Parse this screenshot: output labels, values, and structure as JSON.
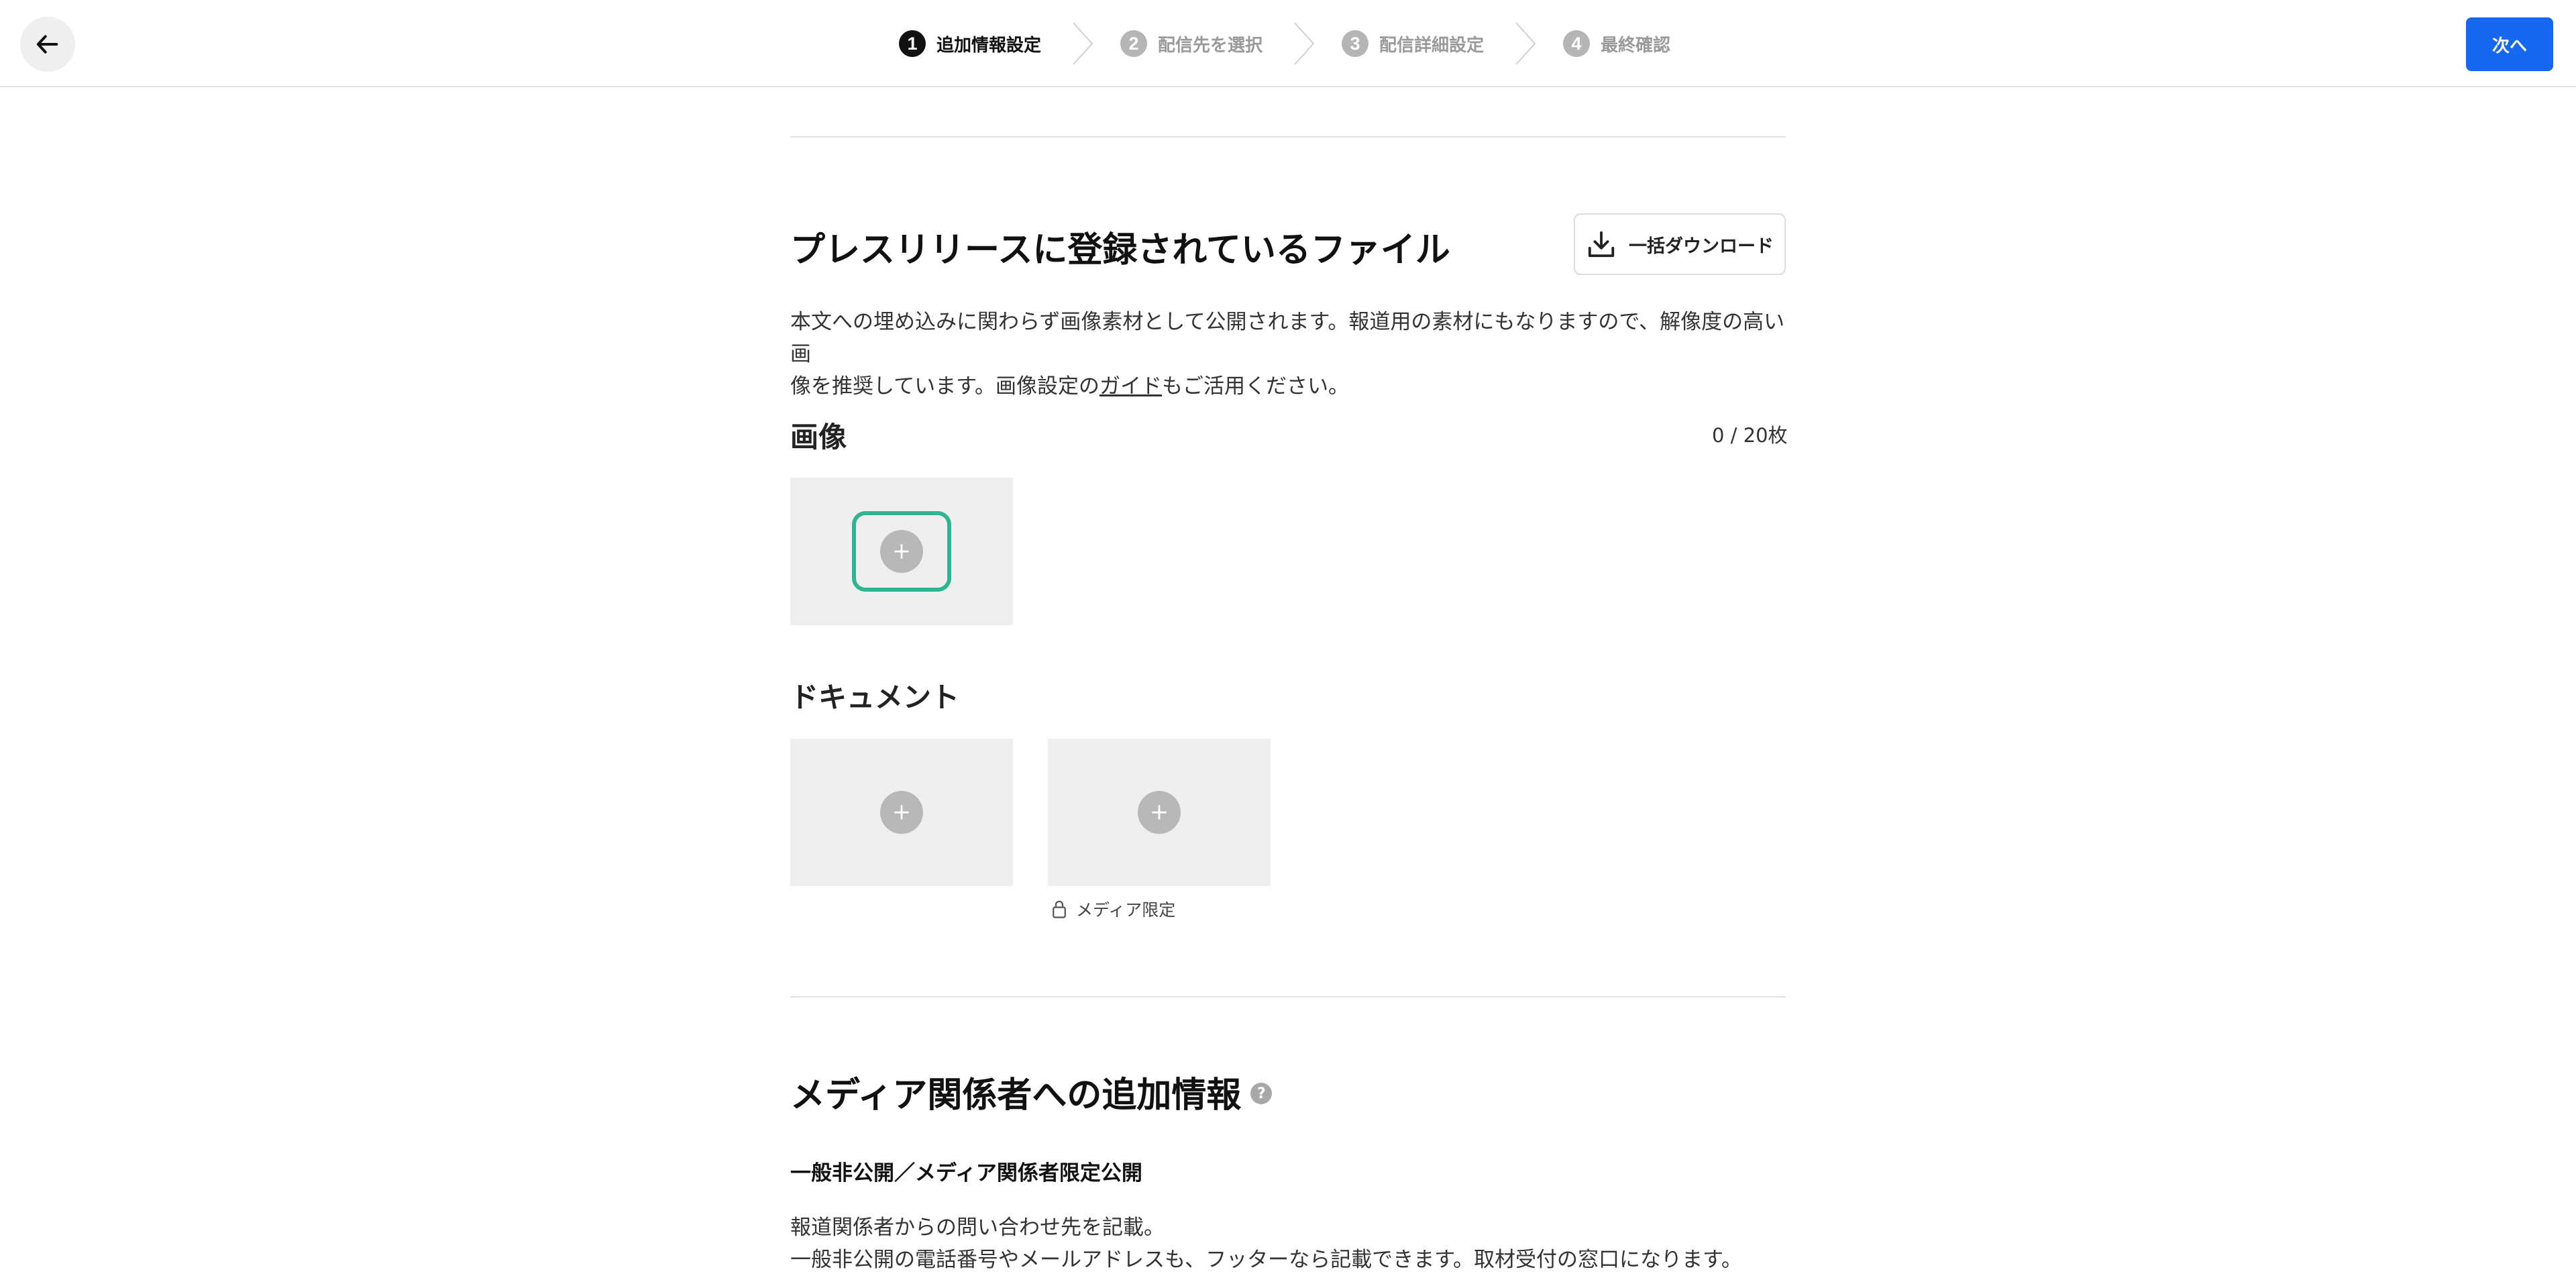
{
  "header": {
    "steps": [
      {
        "num": "1",
        "label": "追加情報設定",
        "active": true
      },
      {
        "num": "2",
        "label": "配信先を選択",
        "active": false
      },
      {
        "num": "3",
        "label": "配信詳細設定",
        "active": false
      },
      {
        "num": "4",
        "label": "最終確認",
        "active": false
      }
    ],
    "next_label": "次へ"
  },
  "files": {
    "title": "プレスリリースに登録されているファイル",
    "download_all_label": "一括ダウンロード",
    "desc_line1": "本文への埋め込みに関わらず画像素材として公開されます。報道用の素材にもなりますので、解像度の高い画",
    "desc_line2_pre": "像を推奨しています。画像設定の",
    "desc_link": "ガイド",
    "desc_line2_post": "もご活用ください。",
    "images": {
      "title": "画像",
      "count": "0 / 20枚"
    },
    "documents": {
      "title": "ドキュメント",
      "restricted_label": "メディア限定"
    }
  },
  "media_info": {
    "title": "メディア関係者への追加情報",
    "help": "?",
    "subheading": "一般非公開／メディア関係者限定公開",
    "desc_line1": "報道関係者からの問い合わせ先を記載。",
    "desc_line2": "一般非公開の電話番号やメールアドレスも、フッターなら記載できます。取材受付の窓口になります。"
  },
  "colors": {
    "primary": "#1668f0",
    "focus": "#2db68f",
    "tile_bg": "#efefef"
  }
}
